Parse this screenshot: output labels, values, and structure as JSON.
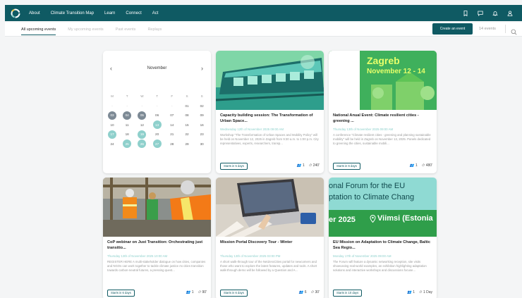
{
  "nav": {
    "links": [
      "About",
      "Climate Transition Map",
      "Learn",
      "Connect",
      "Act"
    ],
    "icons": [
      "bookmark-icon",
      "chat-icon",
      "bell-icon",
      "user-icon"
    ]
  },
  "subbar": {
    "tabs": [
      "All upcoming events",
      "My upcoming events",
      "Past events",
      "Replays"
    ],
    "create_label": "Create an event",
    "count": "14 events"
  },
  "calendar": {
    "month": "November",
    "weekdays": [
      "M",
      "T",
      "W",
      "T",
      "F",
      "S",
      "S"
    ],
    "days": [
      [
        "-",
        "-",
        "-",
        "-",
        "-",
        "01",
        "02"
      ],
      [
        "03",
        "04",
        "05",
        "06",
        "07",
        "08",
        "09"
      ],
      [
        "10",
        "11",
        "12",
        "13",
        "14",
        "15",
        "16"
      ],
      [
        "17",
        "18",
        "19",
        "20",
        "21",
        "22",
        "23"
      ],
      [
        "24",
        "25",
        "26",
        "27",
        "28",
        "29",
        "30"
      ]
    ],
    "highlight_dark": [
      "03",
      "04",
      "05"
    ],
    "highlight_teal": [
      "13",
      "17",
      "19",
      "25",
      "26",
      "27"
    ],
    "muted": [
      "-"
    ]
  },
  "events": [
    {
      "title": "Capacity building session: The Transformation of Urban Space...",
      "date": "Wednesday 12th of November 2025 09:00 AM",
      "desc": "Workshop \"The Transformation of Urban Spaces and Mobility Policy\" will be held on November 12, 2025 in Zagreb from 9:30 a.m. to 1:00 p.m. City representatives, experts, researchers, transp...",
      "starts": "Starts in 5 days",
      "people": "1",
      "duration": "240'"
    },
    {
      "title": "National Anual Event: Climate resilient cities - greening ...",
      "date": "Thursday 13th of November 2025 09:00 AM",
      "desc": "A conference \"Climate resilient cities - greening and planning sustainable mobility\" will be held in Zagreb on November 13, 2025. Panels dedicated to greening the cities, sustainable mobili...",
      "starts": "Starts in 6 days",
      "people": "1",
      "duration": "480'",
      "image_text": [
        "Zagreb",
        "November 12 - 14"
      ]
    },
    {
      "title": "CoP webinar on Just Transition: Orchestrating just transitio...",
      "date": "Thursday 13th of November 2025 10:00 AM",
      "desc": "REGISTER HERE   A multi-stakeholder dialogue on how cities, companies and NGOs can work together to tackle climate justice As cities transition towards carbon-neutral futures, a pressing quest...",
      "starts": "Starts in 6 days",
      "people": "1",
      "duration": "90'"
    },
    {
      "title": "Mission Portal Discovery Tour - Winter",
      "date": "Thursday 13th of November 2025 03:00 PM",
      "desc": "A short walk-through tour of the NetZeroCities portal for newcomers and those who want to explore the latest features, updates and tools. A short walk-through demo will be followed by a Question and A...",
      "starts": "Starts in 6 days",
      "people": "6",
      "duration": "30'"
    },
    {
      "title": "EU Mission on Adaptation to Climate Change, Baltic Sea Regio...",
      "date": "Monday 17th of November 2025 09:00 AM",
      "desc": "The Forum will feature a dynamic networking reception, site visits showcasing real-world examples, an exhibition highlighting adaptation solutions and interactive workshops and discussions focuse...",
      "starts": "Starts in 10 days",
      "people": "1",
      "duration": "1 Day",
      "image_text": [
        "onal Forum for the EU",
        "ptation to Climate Chang",
        "er 2025",
        "Viimsi (Estonia"
      ]
    }
  ],
  "colors": {
    "brand": "#0f5a63",
    "accent_teal": "#8fd0cc",
    "calendar_dark": "#7d8a95",
    "background": "#f4f5f6"
  }
}
